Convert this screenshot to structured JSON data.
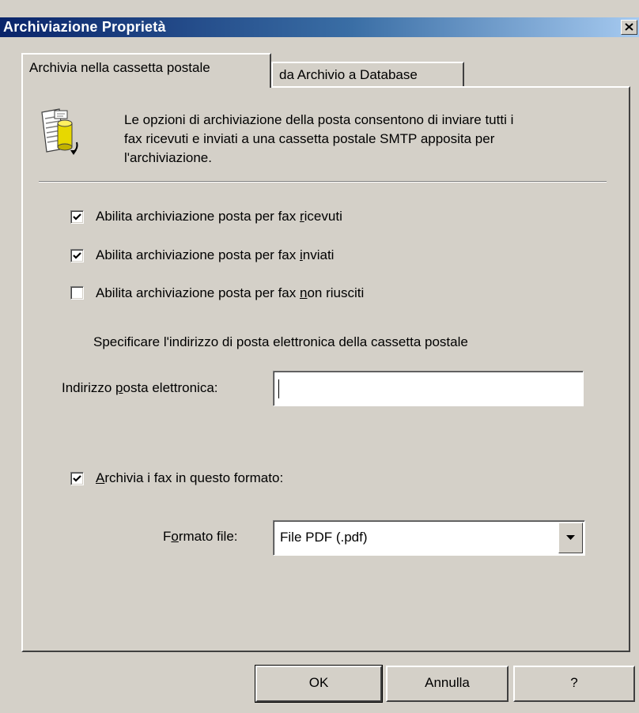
{
  "window": {
    "title": "Archiviazione Proprietà"
  },
  "tabs": [
    {
      "label": "Archivia nella cassetta postale",
      "active": true
    },
    {
      "label": "da Archivio a Database",
      "active": false
    }
  ],
  "description": {
    "lines": [
      "Le opzioni di archiviazione della posta consentono di inviare tutti i",
      "fax ricevuti e inviati a una cassetta postale SMTP apposita per",
      "l'archiviazione."
    ]
  },
  "options": {
    "received": {
      "prefix": "Abilita archiviazione posta per fax ",
      "accel": "r",
      "suffix": "icevuti",
      "checked": true
    },
    "sent": {
      "prefix": "Abilita archiviazione posta per fax ",
      "accel": "i",
      "suffix": "nviati",
      "checked": true
    },
    "failed": {
      "prefix": "Abilita archiviazione posta per fax ",
      "accel": "n",
      "suffix": "on riusciti",
      "checked": false
    }
  },
  "mailbox": {
    "hint": "Specificare l'indirizzo di posta elettronica della cassetta postale",
    "label_prefix": "Indirizzo ",
    "label_accel": "p",
    "label_suffix": "osta elettronica:",
    "value": ""
  },
  "format": {
    "archive_accel": "A",
    "archive_suffix": "rchivia i fax in questo formato:",
    "archive_checked": true,
    "file_label_prefix": "F",
    "file_label_accel": "o",
    "file_label_suffix": "rmato file:",
    "selected": "File PDF (.pdf)"
  },
  "buttons": {
    "ok": "OK",
    "cancel": "Annulla",
    "help": "?"
  },
  "colors": {
    "titlebar_start": "#0a246a",
    "titlebar_end": "#a6caf0",
    "face": "#d4d0c8"
  }
}
